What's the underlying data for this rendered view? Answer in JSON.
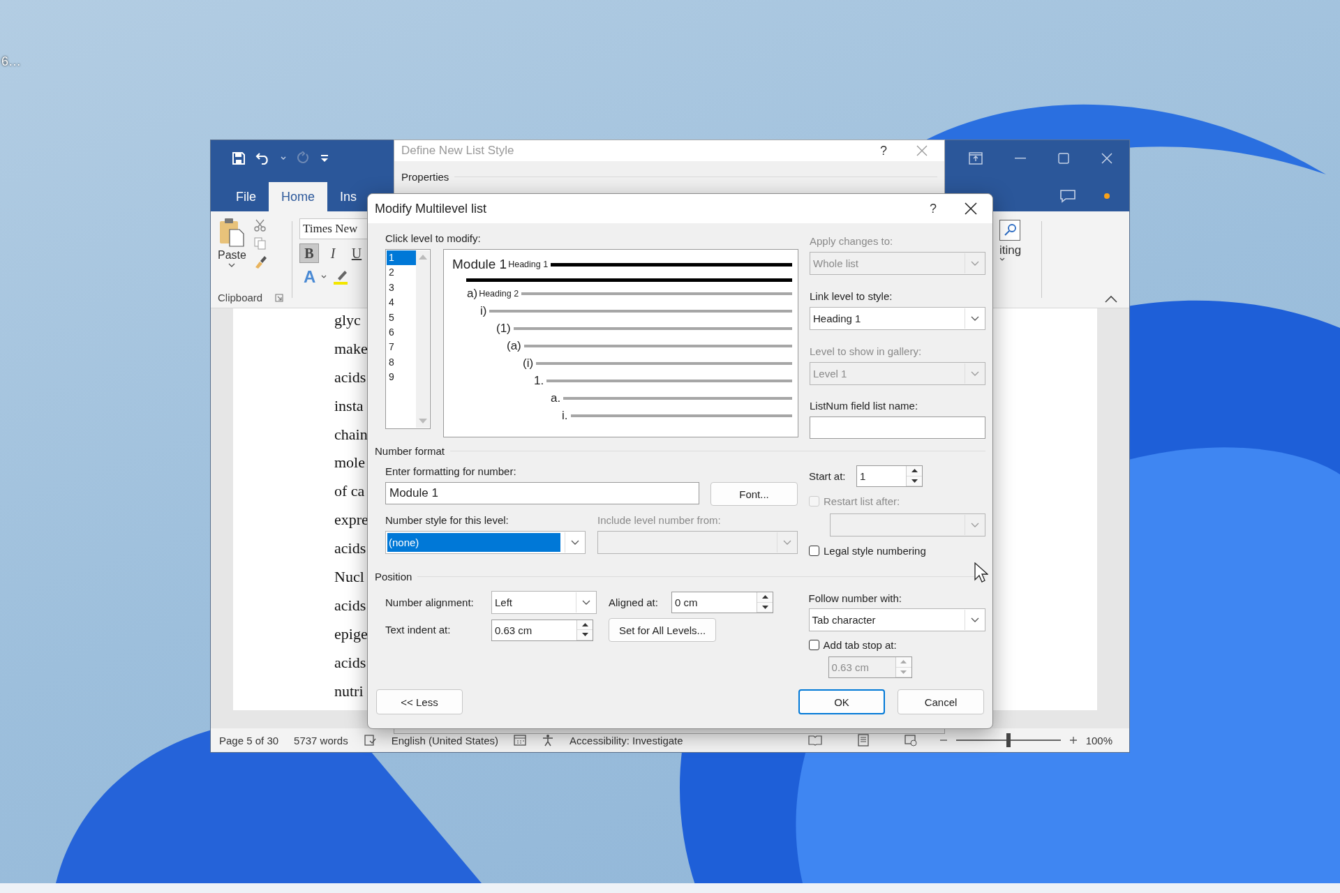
{
  "desktop": {
    "icon_label": "6…"
  },
  "word": {
    "tabs": [
      {
        "label": "File",
        "selected": false
      },
      {
        "label": "Home",
        "selected": true
      },
      {
        "label": "Ins",
        "selected": false
      }
    ],
    "clipboard": {
      "paste": "Paste",
      "group": "Clipboard"
    },
    "font": {
      "name": "Times New",
      "styles": [
        {
          "label": "B",
          "selected": true
        },
        {
          "label": "I",
          "selected": false
        },
        {
          "label": "U",
          "selected": false
        }
      ],
      "effects": "A"
    },
    "editing": {
      "label": "iting"
    },
    "document_lines": [
      "glyc",
      "make",
      "acids",
      "insta",
      "chain",
      "mole",
      "of ca",
      "expre",
      "acids",
      "Nucl",
      "acids",
      "epige",
      "acids",
      "nutri"
    ],
    "status_bar": {
      "page": "Page 5 of 30",
      "words": "5737 words",
      "language": "English (United States)",
      "accessibility": "Accessibility: Investigate",
      "zoom": {
        "level": 0.5,
        "reading": "100%"
      }
    }
  },
  "list_style_dialog": {
    "title": "Define New List Style",
    "help": "?",
    "section": "Properties"
  },
  "modify_dialog": {
    "title": "Modify Multilevel list",
    "help": "?",
    "level_label": "Click level to modify:",
    "levels": [
      {
        "label": "1",
        "selected": true
      },
      {
        "label": "2",
        "selected": false
      },
      {
        "label": "3",
        "selected": false
      },
      {
        "label": "4",
        "selected": false
      },
      {
        "label": "5",
        "selected": false
      },
      {
        "label": "6",
        "selected": false
      },
      {
        "label": "7",
        "selected": false
      },
      {
        "label": "8",
        "selected": false
      },
      {
        "label": "9",
        "selected": false
      }
    ],
    "preview": [
      {
        "number": "Module 1",
        "style": "Heading 1"
      },
      {
        "number": "a)",
        "style": "Heading 2"
      },
      {
        "number": "i)"
      },
      {
        "number": "(1)"
      },
      {
        "number": "(a)"
      },
      {
        "number": "(i)"
      },
      {
        "number": "1."
      },
      {
        "number": "a."
      },
      {
        "number": "i."
      }
    ],
    "apply_changes": {
      "label": "Apply changes to:",
      "value": "Whole list",
      "disabled": true
    },
    "link_style": {
      "label": "Link level to style:",
      "value": "Heading 1",
      "disabled": false
    },
    "gallery_level": {
      "label": "Level to show in gallery:",
      "value": "Level 1",
      "disabled": true
    },
    "listnum_name": {
      "label": "ListNum field list name:"
    },
    "number_format": {
      "heading": "Number format",
      "format_label": "Enter formatting for number:",
      "format_value": "Module 1",
      "font_button": "Font...",
      "style": {
        "label": "Number style for this level:",
        "value": "(none)",
        "focused": true,
        "disabled": false
      },
      "include": {
        "label": "Include level number from:",
        "disabled": true
      },
      "start": {
        "label": "Start at:",
        "value": "1"
      },
      "restart": {
        "label": "Restart list after:",
        "checked": false,
        "disabled": true
      },
      "restart_select": {
        "disabled": true
      },
      "legal": {
        "label": "Legal style numbering",
        "checked": false,
        "disabled": false
      }
    },
    "position": {
      "heading": "Position",
      "alignment": {
        "label": "Number alignment:",
        "value": "Left",
        "disabled": false
      },
      "aligned_at": {
        "label": "Aligned at:",
        "value": "0 cm",
        "disabled": false
      },
      "text_indent": {
        "label": "Text indent at:",
        "value": "0.63 cm",
        "disabled": false
      },
      "set_all_button": "Set for All Levels...",
      "follow": {
        "label": "Follow number with:",
        "value": "Tab character",
        "disabled": false
      },
      "add_tab": {
        "label": "Add tab stop at:",
        "checked": false,
        "disabled": false
      },
      "tab_stop": {
        "value": "0.63 cm",
        "disabled": true
      }
    },
    "buttons": [
      {
        "label": "<< Less",
        "default": false
      },
      {
        "label": "OK",
        "default": true
      },
      {
        "label": "Cancel",
        "default": false
      }
    ]
  }
}
